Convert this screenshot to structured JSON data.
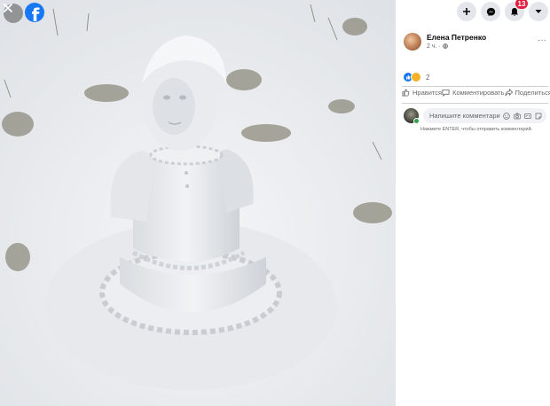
{
  "header": {
    "notifications_count": "13",
    "icons": [
      "plus-icon",
      "messenger-icon",
      "bell-icon",
      "caret-down-icon"
    ]
  },
  "photo": {
    "description_icon": "close-icon",
    "logo_letter": "f"
  },
  "post": {
    "author_name": "Елена Петренко",
    "time": "2 ч.",
    "more": "···",
    "reaction_count": "2",
    "actions": {
      "like": "Нравится",
      "comment": "Комментировать",
      "share": "Поделиться"
    }
  },
  "comment": {
    "placeholder": "Напишите комментарий...",
    "hint": "Нажмите ENTER, чтобы отправить комментарий."
  },
  "colors": {
    "brand": "#1877f2",
    "badge": "#e41e3f",
    "secondary_text": "#65676b"
  }
}
